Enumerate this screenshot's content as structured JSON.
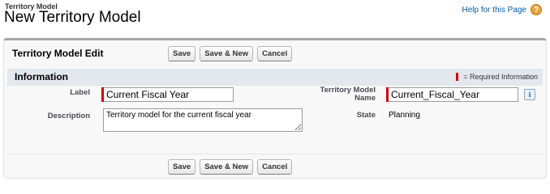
{
  "header": {
    "page_type": "Territory Model",
    "title": "New Territory Model",
    "help_link": "Help for this Page",
    "help_icon": "help-icon"
  },
  "panel": {
    "title": "Territory Model Edit",
    "buttons": {
      "save": "Save",
      "save_new": "Save & New",
      "cancel": "Cancel"
    }
  },
  "section": {
    "title": "Information",
    "required_legend": "= Required Information",
    "required_color": "#cc0000"
  },
  "fields": {
    "label": {
      "label": "Label",
      "value": "Current Fiscal Year"
    },
    "description": {
      "label": "Description",
      "value": "Territory model for the current fiscal year"
    },
    "territory_model_name": {
      "label_line1": "Territory Model",
      "label_line2": "Name",
      "value": "Current_Fiscal_Year",
      "info_icon": "i"
    },
    "state": {
      "label": "State",
      "value": "Planning"
    }
  }
}
